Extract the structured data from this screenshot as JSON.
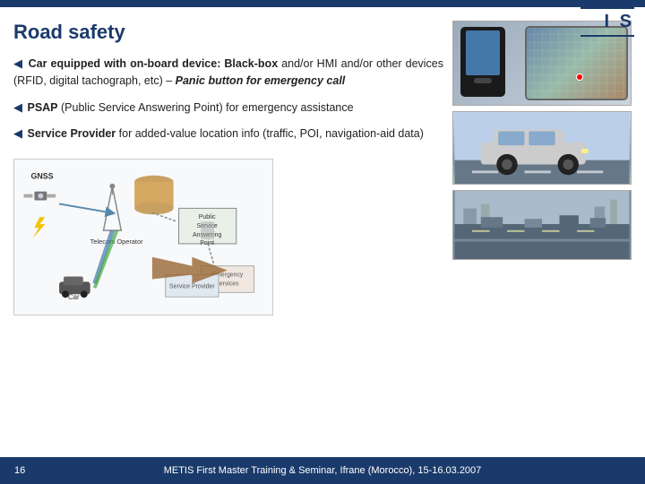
{
  "slide": {
    "title": "Road safety",
    "bullets": [
      {
        "id": "bullet1",
        "arrow": "◀",
        "text_before_strong": "Car equipped with on-board device: ",
        "strong": "Black-box",
        "text_after_strong": " and/or HMI and/or other devices (RFID, digital tachograph, etc) – ",
        "italic": "Panic button for emergency call"
      },
      {
        "id": "bullet2",
        "arrow": "◀",
        "strong_start": "PSAP",
        "text": " (Public Service Answering Point) for emergency assistance"
      },
      {
        "id": "bullet3",
        "arrow": "◀",
        "strong": "Service Provider",
        "text": " for added-value location info (traffic, POI, navigation-aid data)"
      }
    ],
    "footer": {
      "page_number": "16",
      "text": "METIS First Master Training & Seminar, Ifrane (Morocco), 15-16.03.2007"
    },
    "is_logo": "I S",
    "diagram": {
      "gnss_label": "GNSS",
      "telecom_label": "Telecom Operator",
      "psap_label": "Public Service Answering Point",
      "emergency_label": "Emergency services",
      "service_label": "Service Provider",
      "car_label": "Car"
    }
  }
}
